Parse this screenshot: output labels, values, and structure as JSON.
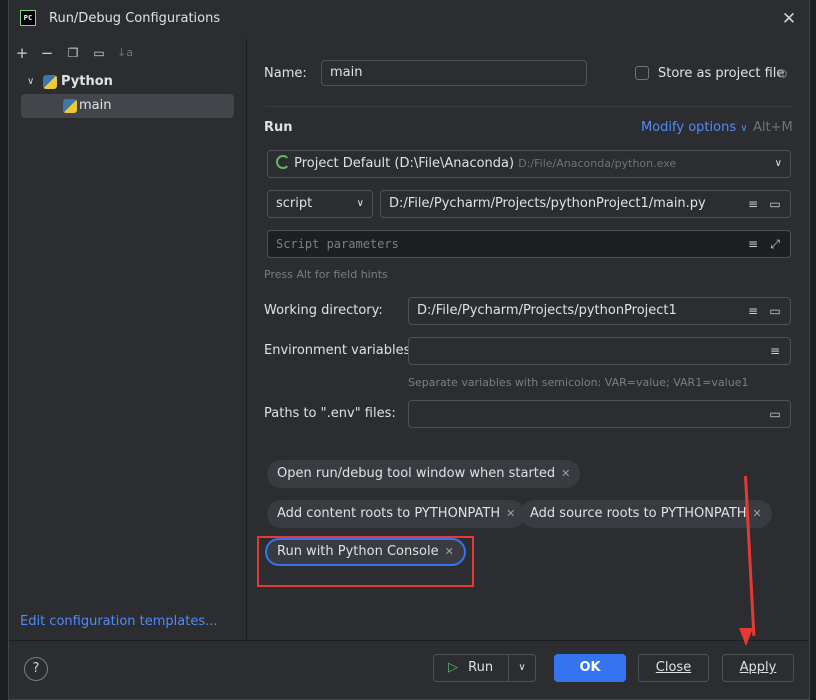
{
  "window": {
    "title": "Run/Debug Configurations",
    "app_icon_text": "PC"
  },
  "tree": {
    "group": "Python",
    "item": "main"
  },
  "left": {
    "edit_templates": "Edit configuration templates..."
  },
  "form": {
    "name_label": "Name:",
    "name_value": "main",
    "store_label": "Store as project file",
    "run_heading": "Run",
    "modify_options": "Modify options",
    "modify_shortcut": "Alt+M",
    "interpreter": "Project Default (D:\\File\\Anaconda)",
    "interpreter_path": "D:/File/Anaconda/python.exe",
    "script_mode": "script",
    "script_path": "D:/File/Pycharm/Projects/pythonProject1/main.py",
    "script_params_placeholder": "Script parameters",
    "field_hint": "Press Alt for field hints",
    "working_dir_label": "Working directory:",
    "working_dir_value": "D:/File/Pycharm/Projects/pythonProject1",
    "env_label": "Environment variables:",
    "env_hint": "Separate variables with semicolon: VAR=value; VAR1=value1",
    "dotenv_label": "Paths to \".env\" files:"
  },
  "chips": [
    "Open run/debug tool window when started",
    "Add content roots to PYTHONPATH",
    "Add source roots to PYTHONPATH",
    "Run with Python Console"
  ],
  "footer": {
    "help": "?",
    "run": "Run",
    "ok": "OK",
    "close": "Close",
    "apply": "Apply"
  },
  "colors": {
    "accent": "#3574f0",
    "highlight": "#e53935",
    "link": "#548af7"
  }
}
